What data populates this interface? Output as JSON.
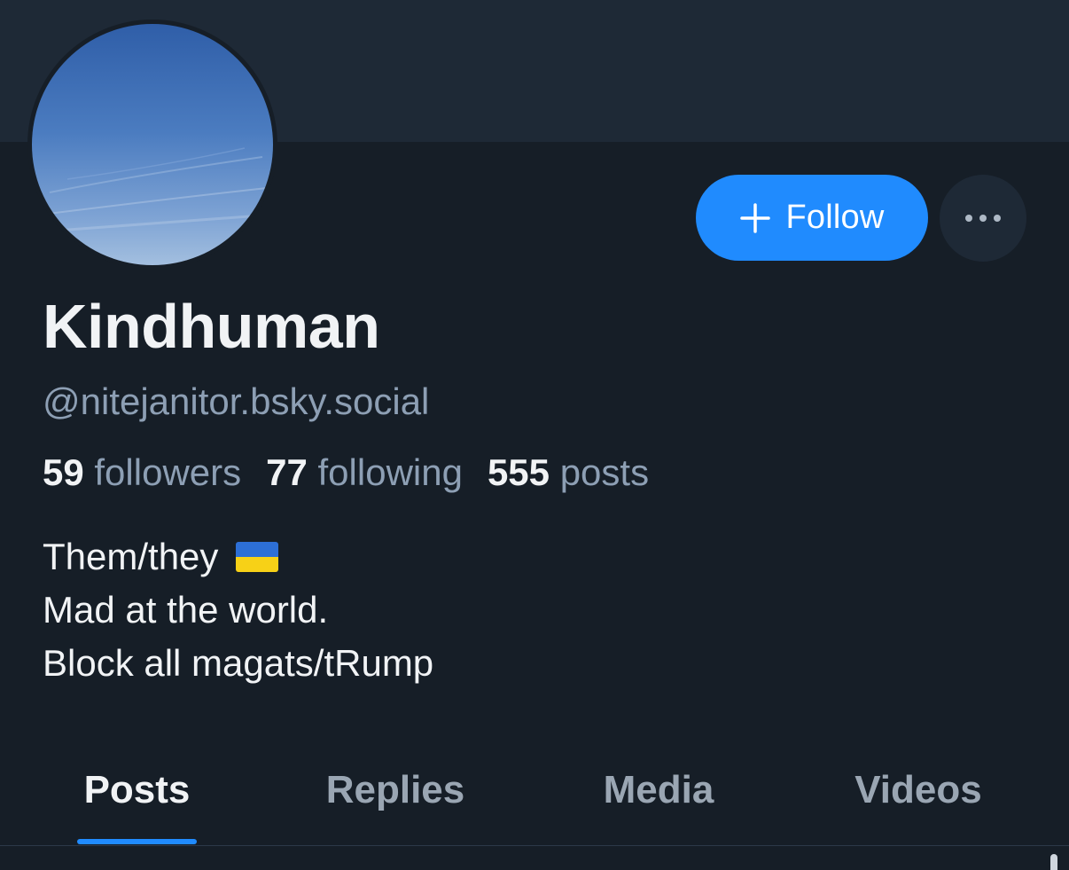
{
  "profile": {
    "display_name": "Kindhuman",
    "handle": "@nitejanitor.bsky.social",
    "avatar_icon": "sky-avatar"
  },
  "actions": {
    "follow_label": "Follow",
    "follow_icon": "plus-icon",
    "more_icon": "ellipsis-icon"
  },
  "stats": {
    "followers_count": "59",
    "followers_label": "followers",
    "following_count": "77",
    "following_label": "following",
    "posts_count": "555",
    "posts_label": "posts"
  },
  "bio": {
    "line1": "Them/they",
    "line1_emoji": "ukraine-flag-icon",
    "line2": "Mad at the world.",
    "line3": "Block all magats/tRump"
  },
  "tabs": [
    {
      "label": "Posts",
      "active": true
    },
    {
      "label": "Replies",
      "active": false
    },
    {
      "label": "Media",
      "active": false
    },
    {
      "label": "Videos",
      "active": false
    }
  ],
  "colors": {
    "background": "#161e27",
    "banner": "#1e2936",
    "accent": "#208bfe",
    "text_primary": "#f1f3f5",
    "text_secondary": "#8d9fb4"
  }
}
